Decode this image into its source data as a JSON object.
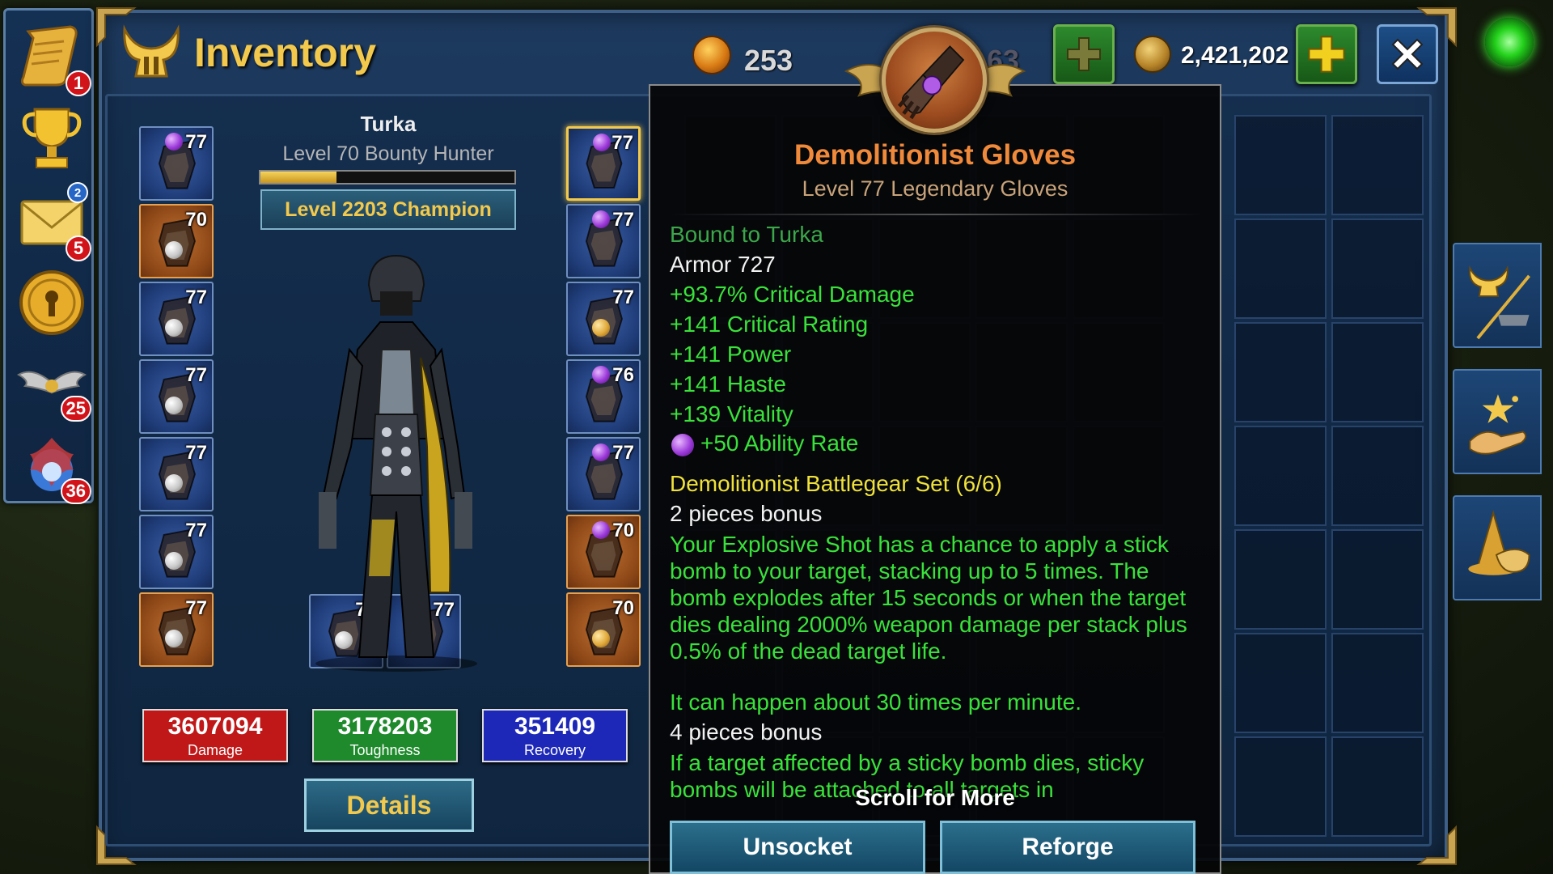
{
  "header": {
    "title": "Inventory",
    "currency_orb_value": "253",
    "currency_gold_value": "2,421,202",
    "hidden_partial_value": "63"
  },
  "sidebar": {
    "badges": {
      "quests": "1",
      "mail_blue": "2",
      "mail_red": "5",
      "wings": "25",
      "fireball": "36"
    }
  },
  "character": {
    "name": "Turka",
    "class_line": "Level 70 Bounty Hunter",
    "xp_fraction": 0.3,
    "champion_label": "Level 2203 Champion"
  },
  "left_slots": [
    {
      "name": "slot-helm",
      "level": "77",
      "gem": "purple",
      "style": "blue"
    },
    {
      "name": "slot-amulet",
      "level": "70",
      "gem": "white",
      "style": "orange"
    },
    {
      "name": "slot-shoulders",
      "level": "77",
      "gem": "white",
      "style": "blue"
    },
    {
      "name": "slot-chest",
      "level": "77",
      "gem": "white",
      "style": "blue"
    },
    {
      "name": "slot-cloak",
      "level": "77",
      "gem": "white",
      "style": "blue"
    },
    {
      "name": "slot-relic",
      "level": "77",
      "gem": "white",
      "style": "blue"
    },
    {
      "name": "slot-offhand",
      "level": "77",
      "gem": "white",
      "style": "orange"
    }
  ],
  "right_slots": [
    {
      "name": "slot-gloves",
      "level": "77",
      "gem": "purple",
      "style": "blue"
    },
    {
      "name": "slot-bracers",
      "level": "77",
      "gem": "purple",
      "style": "blue"
    },
    {
      "name": "slot-belt",
      "level": "77",
      "gem": "gold",
      "style": "blue"
    },
    {
      "name": "slot-pants",
      "level": "76",
      "gem": "purple",
      "style": "blue"
    },
    {
      "name": "slot-boots",
      "level": "77",
      "gem": "purple",
      "style": "blue"
    },
    {
      "name": "slot-ring-1",
      "level": "70",
      "gem": "purple",
      "style": "orange"
    },
    {
      "name": "slot-ring-2",
      "level": "70",
      "gem": "gold",
      "style": "orange"
    }
  ],
  "weapon_slots": [
    {
      "name": "slot-weapon-main",
      "level": "77"
    },
    {
      "name": "slot-weapon-off",
      "level": "77"
    }
  ],
  "stats": {
    "damage_value": "3607094",
    "damage_label": "Damage",
    "toughness_value": "3178203",
    "toughness_label": "Toughness",
    "recovery_value": "351409",
    "recovery_label": "Recovery",
    "damage_color": "#c01818",
    "toughness_color": "#1e8a2c",
    "recovery_color": "#1d28b8"
  },
  "details_button": "Details",
  "tooltip": {
    "item_name": "Demolitionist Gloves",
    "item_subtitle": "Level 77 Legendary Gloves",
    "bound": "Bound to Turka",
    "armor": "Armor 727",
    "stats": [
      "+93.7% Critical Damage",
      "+141 Critical Rating",
      "+141 Power",
      "+141 Haste",
      "+139 Vitality"
    ],
    "socket_stat": "+50 Ability Rate",
    "set_name": "Demolitionist Battlegear Set (6/6)",
    "bonus2_header": "2 pieces bonus",
    "bonus2_text": "Your Explosive Shot has a chance to apply a stick bomb to your target, stacking up to 5 times. The bomb explodes after 15 seconds or when the target dies dealing 2000% weapon damage per stack plus 0.5% of the dead target life.",
    "bonus2_rate": "It can happen about 30 times per minute.",
    "bonus4_header": "4 pieces bonus",
    "bonus4_text": "If a target affected by a sticky bomb dies, sticky bombs will be attached to all targets in",
    "scroll_hint": "Scroll for More",
    "unsocket_label": "Unsocket",
    "reforge_label": "Reforge"
  }
}
